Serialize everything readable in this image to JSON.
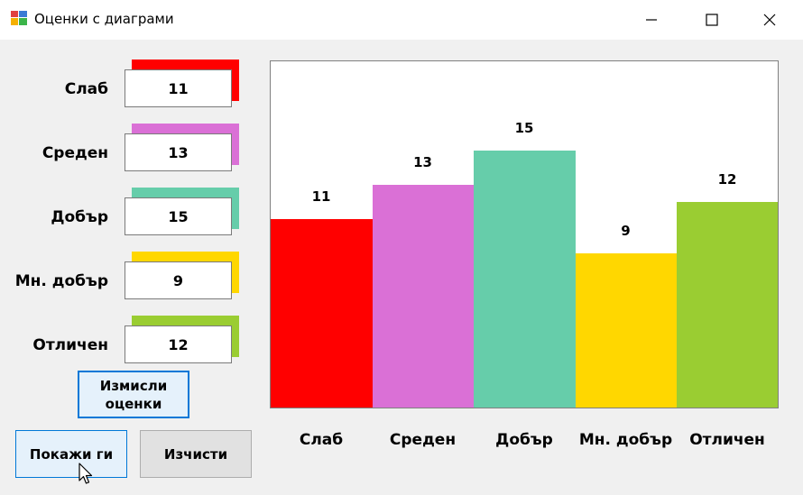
{
  "window": {
    "title": "Оценки с диаграми",
    "min": "—",
    "max": "☐",
    "close": "✕"
  },
  "rows": [
    {
      "label": "Слаб",
      "value": "11",
      "color": "#ff0000"
    },
    {
      "label": "Среден",
      "value": "13",
      "color": "#da70d6"
    },
    {
      "label": "Добър",
      "value": "15",
      "color": "#66cdaa"
    },
    {
      "label": "Мн. добър",
      "value": "9",
      "color": "#ffd700"
    },
    {
      "label": "Отличен",
      "value": "12",
      "color": "#9acd32"
    }
  ],
  "buttons": {
    "generate": "Измисли оценки",
    "show": "Покажи ги",
    "clear": "Изчисти"
  },
  "icons": {
    "app": "app-icon",
    "cursor": "mouse-cursor-icon"
  },
  "chart_data": {
    "type": "bar",
    "categories": [
      "Слаб",
      "Среден",
      "Добър",
      "Мн. добър",
      "Отличен"
    ],
    "values": [
      11,
      13,
      15,
      9,
      12
    ],
    "colors": [
      "#ff0000",
      "#da70d6",
      "#66cdaa",
      "#ffd700",
      "#9acd32"
    ],
    "ylim": [
      0,
      20
    ],
    "grid": false,
    "data_labels": true
  }
}
